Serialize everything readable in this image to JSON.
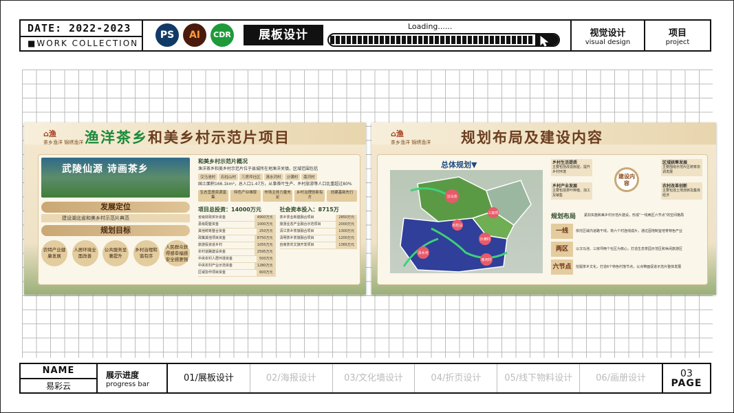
{
  "header": {
    "date": "DATE: 2022-2023",
    "collection": "■WORK COLLECTION",
    "apps": [
      {
        "label": "PS",
        "color": "#123a66"
      },
      {
        "label": "AI",
        "color": "#4a1b0c"
      },
      {
        "label": "CDR",
        "color": "#1f9a3a"
      }
    ],
    "title": "展板设计",
    "loading": "Loading......",
    "visual_cn": "视觉设计",
    "visual_en": "visual design",
    "project_cn": "项目",
    "project_en": "project"
  },
  "board1": {
    "logo_text": "茶乡渔洋 锦绣渔洋",
    "title_green": "渔洋茶乡",
    "title_rest": "和美乡村示范片项目",
    "hero": "武陵仙源 诗画茶乡",
    "pos_title": "发展定位",
    "pos_text": "建设湖北省和美乡村示范片典范",
    "goal_title": "规划目标",
    "goals": [
      "农特产业健康发展",
      "人居环境全面改善",
      "公共服务显著提升",
      "乡村治理和谐有序",
      "人民群众获得感幸福感安全感更强"
    ],
    "overview_title": "和美乡村示范片概况",
    "overview_text": "渔洋茶乡和美乡村示范片位于县城所在地渔洋关镇，区域范围包括",
    "villages": [
      "汉马池村",
      "石柱山村",
      "三房坪社区",
      "清水河村",
      "沙满村",
      "南河村"
    ],
    "area_text": "国土面积166.1km²，总人口1.47万，从事茶叶生产、乡村旅游等人口比重超过80%",
    "chips": [
      "生态宜居资源富集",
      "特色产业雄厚",
      "市场主体力量充足",
      "乡村治理创新有方",
      "创建基础先行"
    ],
    "invest_title": "项目总投资：14000万元",
    "social_title": "社会资本投入：8715万",
    "invest_rows": [
      {
        "k": "省级财政奖补资金",
        "v": "4900万元"
      },
      {
        "k": "县级配套资金",
        "v": "1000万元"
      },
      {
        "k": "其他统筹整合资金",
        "v": "250万元"
      },
      {
        "k": "政策其他项目资金",
        "v": "8750万元"
      },
      {
        "k": "旅游投资进乡村",
        "v": "1055万元"
      },
      {
        "k": "农村道路建设资金",
        "v": "2595万元"
      },
      {
        "k": "中央农村人居环境资金",
        "v": "500万元"
      },
      {
        "k": "中央农村产业示范资金",
        "v": "1280万元"
      },
      {
        "k": "区域协作项目资金",
        "v": "600万元"
      }
    ],
    "social_rows": [
      {
        "k": "茶乡茶业新建融合项目",
        "v": "2850万元"
      },
      {
        "k": "旅游业态产业融合示范项目",
        "v": "2000万元"
      },
      {
        "k": "清江茶乡茶旅融合项目",
        "v": "1300万元"
      },
      {
        "k": "清明茶乡茶旅融合项目",
        "v": "1200万元"
      },
      {
        "k": "自南茶农文旅开发项目",
        "v": "1365万元"
      }
    ]
  },
  "board2": {
    "logo_text": "茶乡渔洋 锦绣渔洋",
    "title": "规划布局及建设内容",
    "map_title": "总体规划▼",
    "map_labels": [
      "汉马池",
      "三房坪",
      "石柱山",
      "沙满村",
      "清水河",
      "南河村"
    ],
    "cards": [
      {
        "t": "乡村生活提质",
        "d": "主要包括改造房屋，提升乡村环境"
      },
      {
        "t": "区域统筹发展",
        "d": "主要围绕示范片区统筹协调发展"
      },
      {
        "t": "乡村产业发展",
        "d": "主要包括茶叶种植、加工及销售"
      },
      {
        "t": "农村改革创新",
        "d": "主要包括土地流转及集体经济"
      }
    ],
    "center": "建设内容",
    "layout_title": "规划布局",
    "layout_sub": "紧扣实施和美乡村示范片建设，形成“一线两区六节点”的空间格局",
    "layout_rows": [
      {
        "k": "一线",
        "v": "依托区域内道路干线，将六个村连线成片，通过因地制宜培育特色产业"
      },
      {
        "k": "两区",
        "v": "以汉马池、三房坪两个社区为核心，打造生态茶园示范区和休闲旅游区"
      },
      {
        "k": "六节点",
        "v": "挖掘茶乡文化，打造6个特色村落节点，以点带面促进示范片整体发展"
      }
    ]
  },
  "footer": {
    "name_label": "NAME",
    "name": "易彩云",
    "progress_cn": "展示进度",
    "progress_en": "progress bar",
    "steps": [
      "01/展板设计",
      "02/海报设计",
      "03/文化墙设计",
      "04/折页设计",
      "05/线下物料设计",
      "06/画册设计"
    ],
    "page_num": "03",
    "page_label": "PAGE"
  }
}
